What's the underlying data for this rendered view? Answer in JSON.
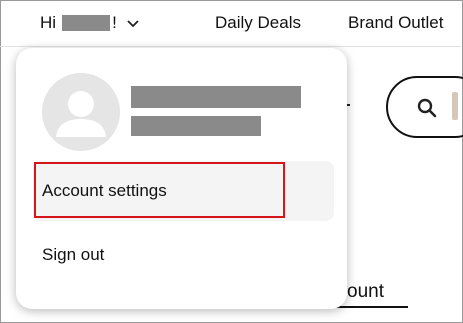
{
  "nav": {
    "greeting_prefix": "Hi",
    "greeting_suffix": "!",
    "links": [
      "Daily Deals",
      "Brand Outlet"
    ]
  },
  "menu": {
    "items": [
      {
        "label": "Account settings",
        "highlighted": true
      },
      {
        "label": "Sign out"
      }
    ]
  },
  "background": {
    "account_tab_label": "ccount"
  },
  "colors": {
    "highlight": "#d6141c",
    "redaction": "#8a8a8a",
    "avatar_bg": "#e5e5e5"
  }
}
